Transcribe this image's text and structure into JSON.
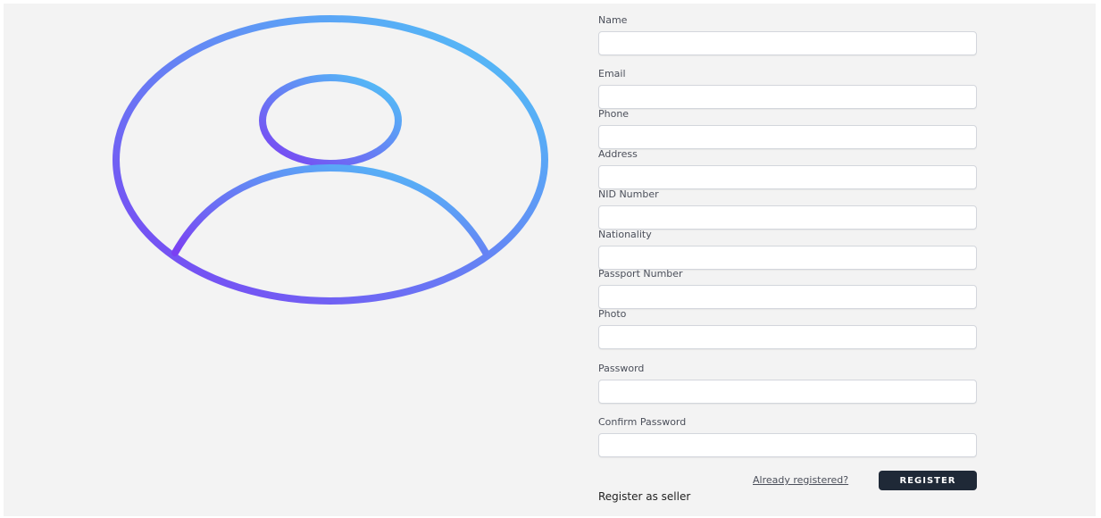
{
  "avatar": {
    "icon": "user-profile-icon",
    "gradient": [
      "#7b3ff2",
      "#4fc8f7"
    ]
  },
  "form": {
    "fields": [
      {
        "key": "name",
        "label": "Name",
        "value": ""
      },
      {
        "key": "email",
        "label": "Email",
        "value": ""
      },
      {
        "key": "phone",
        "label": "Phone",
        "value": ""
      },
      {
        "key": "address",
        "label": "Address",
        "value": ""
      },
      {
        "key": "nid",
        "label": "NID Number",
        "value": ""
      },
      {
        "key": "nationality",
        "label": "Nationality",
        "value": ""
      },
      {
        "key": "passport",
        "label": "Passport Number",
        "value": ""
      },
      {
        "key": "photo",
        "label": "Photo",
        "value": ""
      },
      {
        "key": "password",
        "label": "Password",
        "value": ""
      },
      {
        "key": "confirm_password",
        "label": "Confirm Password",
        "value": ""
      }
    ],
    "already_registered_link": "Already registered?",
    "register_button": "REGISTER",
    "register_seller_link": "Register as seller"
  },
  "colors": {
    "background": "#f3f3f3",
    "button": "#1f2937",
    "button_text": "#ffffff"
  }
}
